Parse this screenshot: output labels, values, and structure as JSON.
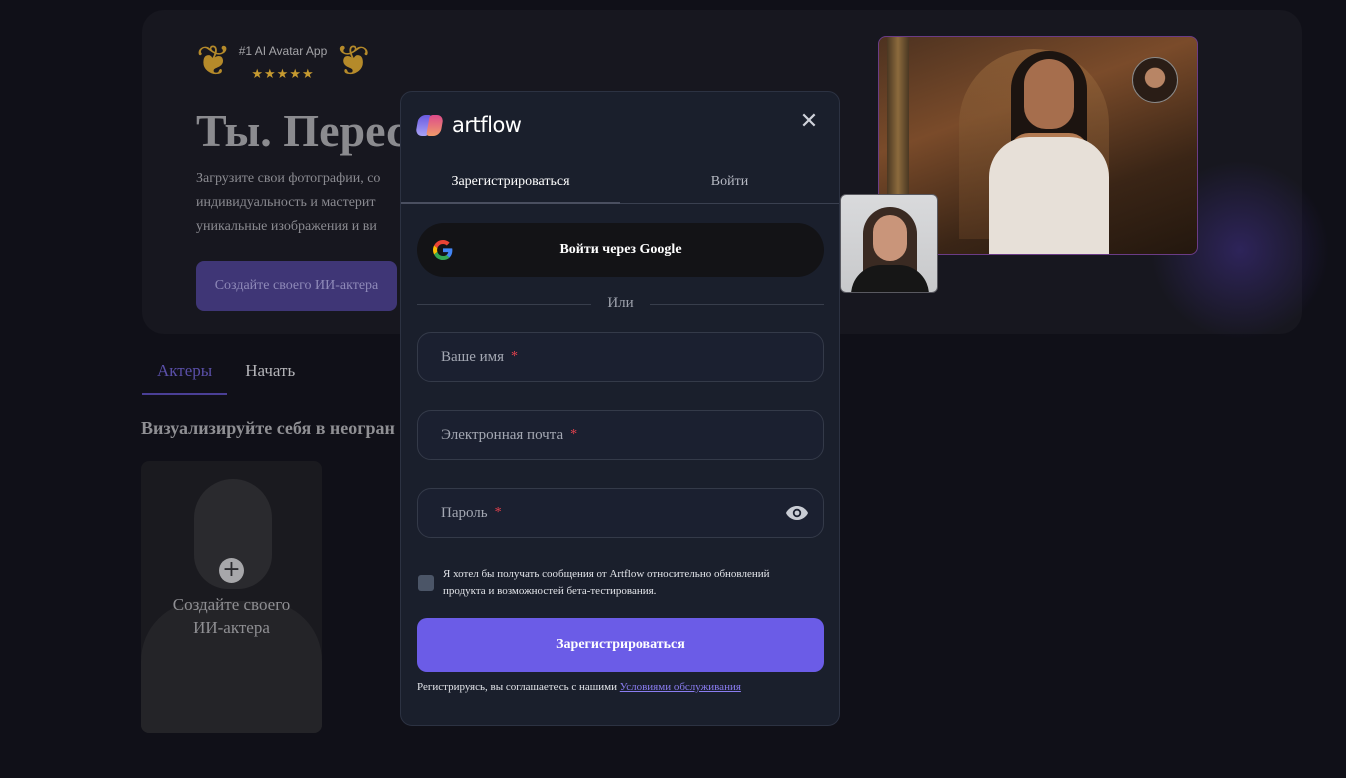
{
  "background": {
    "award": {
      "title": "#1 AI Avatar App",
      "stars": "★★★★★"
    },
    "hero_title": "Ты. Перес",
    "hero_description": [
      "Загрузите свои фотографии, со",
      "индивидуальность и мастерит",
      " уникальные изображения и ви"
    ],
    "cta_label": "Создайте своего ИИ-актера",
    "tabs": [
      "Актеры",
      "Начать"
    ],
    "section_heading": "Визуализируйте себя в неогран",
    "actor_card": {
      "label_line1": "Создайте своего",
      "label_line2": "ИИ-актера",
      "plus": "+"
    }
  },
  "modal": {
    "logo_text": "artflow",
    "close_glyph": "✕",
    "tabs": [
      "Зарегистрироваться",
      "Войти"
    ],
    "google_button_label": "Войти через Google",
    "divider_label": "Или",
    "fields": {
      "name_placeholder": "Ваше имя",
      "email_placeholder": "Электронная почта",
      "password_placeholder": "Пароль",
      "required_mark": "*"
    },
    "consent_text": "Я хотел бы получать сообщения от Artflow относительно обновлений продукта и возможностей бета-тестирования.",
    "submit_label": "Зарегистрироваться",
    "terms_prefix": "Регистрируясь, вы соглашаетесь с нашими ",
    "terms_link": "Условиями обслуживания"
  },
  "colors": {
    "accent": "#6b5ce7",
    "modal_bg": "#1a1f2c",
    "required": "#e2414d",
    "link": "#8a7cf0"
  },
  "icons": [
    "laurel-icon",
    "star-icon",
    "plus-icon",
    "close-icon",
    "google-icon",
    "eye-icon",
    "artflow-logo-icon"
  ]
}
